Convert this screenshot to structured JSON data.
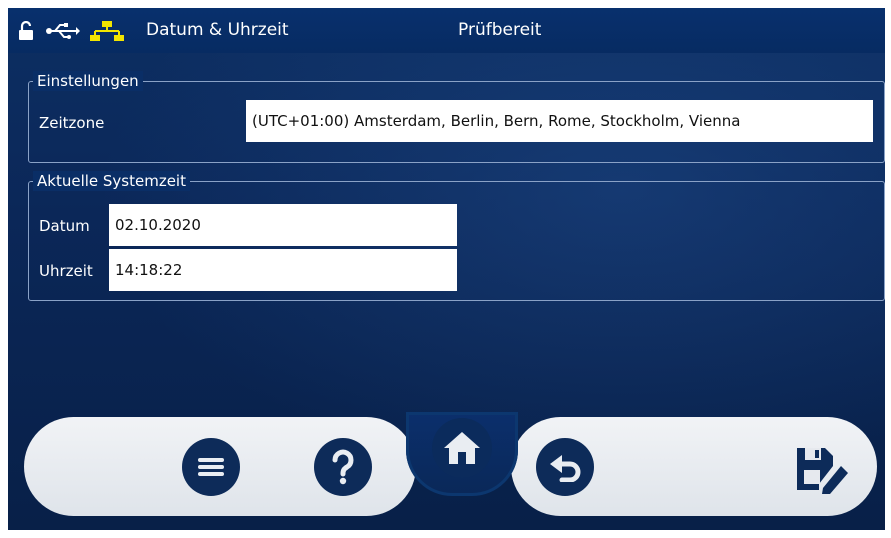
{
  "header": {
    "title": "Datum & Uhrzeit",
    "status": "Prüfbereit",
    "icons": [
      "unlock-icon",
      "usb-icon",
      "network-icon"
    ]
  },
  "settings": {
    "legend": "Einstellungen",
    "timezone_label": "Zeitzone",
    "timezone_value": "(UTC+01:00) Amsterdam, Berlin, Bern, Rome, Stockholm, Vienna"
  },
  "system_time": {
    "legend": "Aktuelle Systemzeit",
    "date_label": "Datum",
    "date_value": "02.10.2020",
    "time_label": "Uhrzeit",
    "time_value": "14:18:22"
  },
  "dock": {
    "buttons": [
      "menu-icon",
      "help-icon",
      "home-icon",
      "undo-icon",
      "save-edit-icon"
    ]
  },
  "colors": {
    "background": "#0b2758",
    "accent_yellow": "#f2e500",
    "dock": "#e6e9ee",
    "button": "#0d2b59"
  }
}
